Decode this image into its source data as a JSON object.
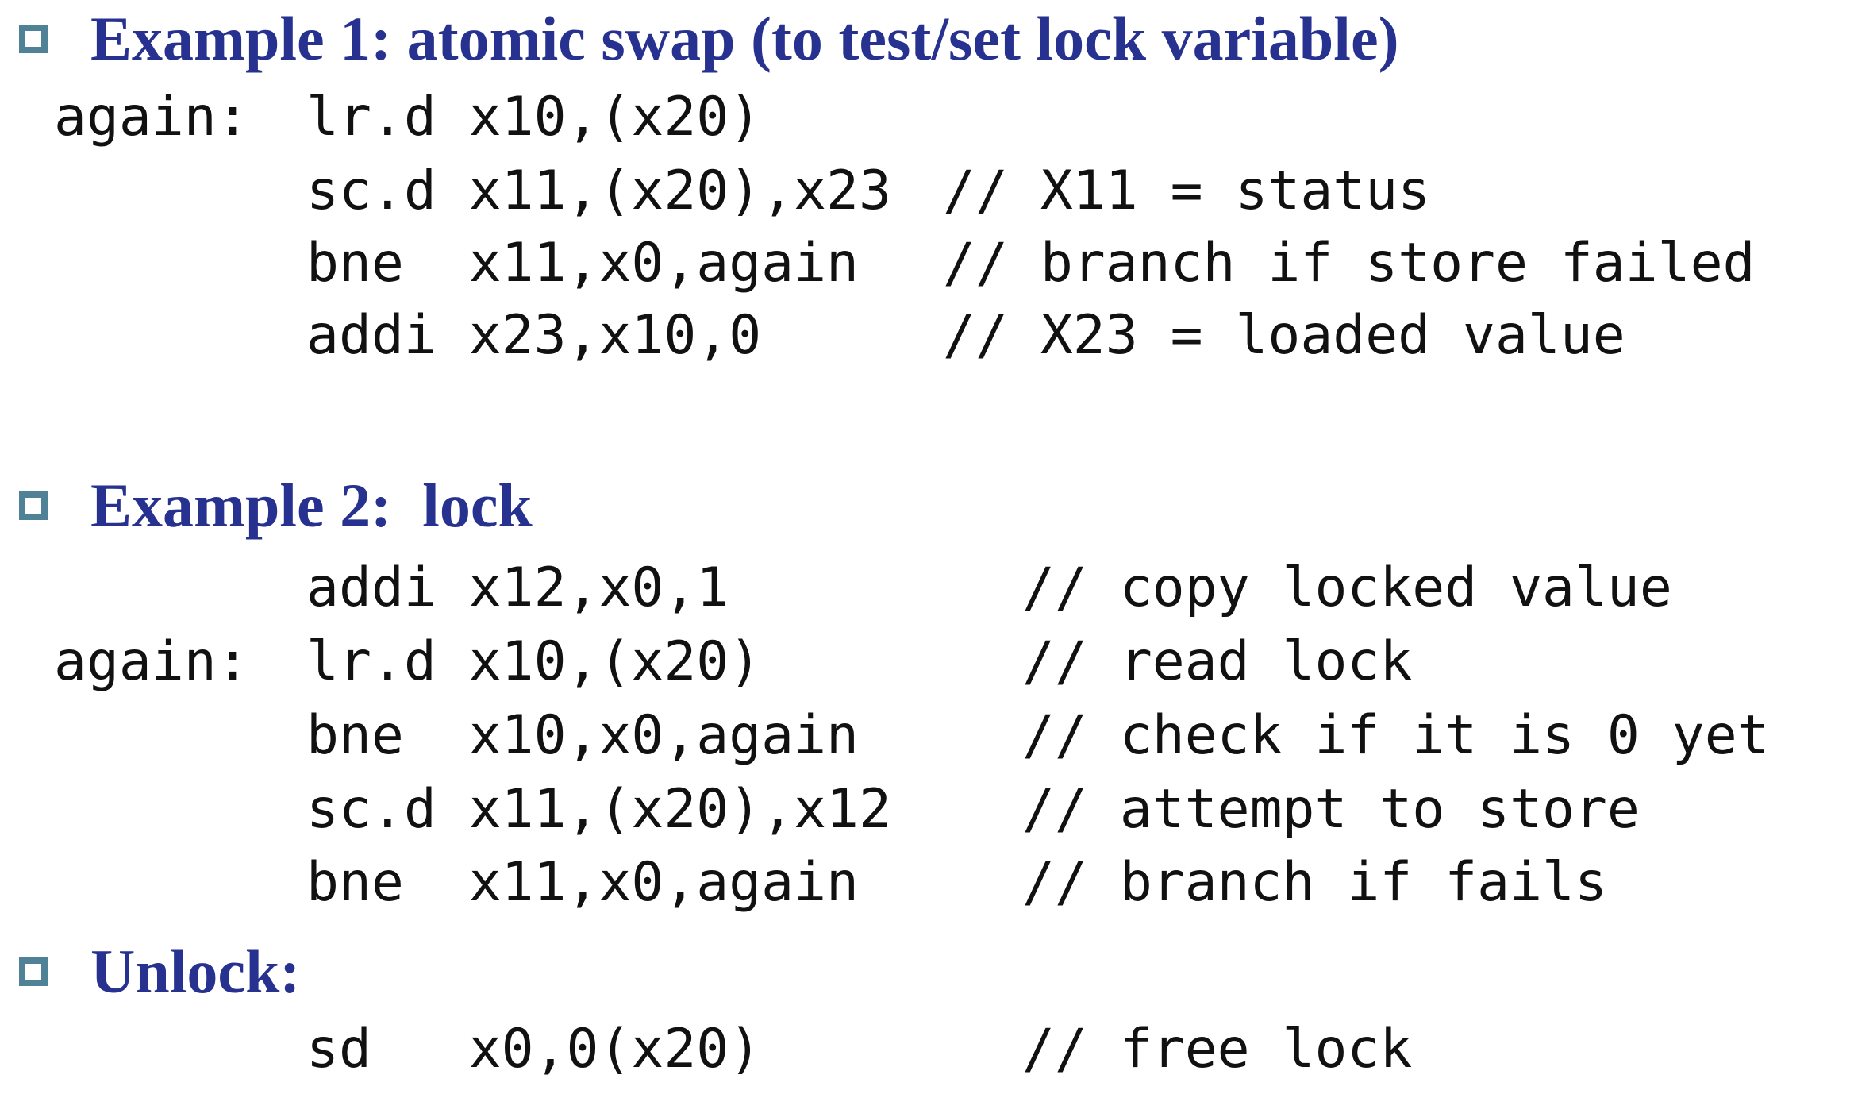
{
  "sections": [
    {
      "heading": "Example 1: atomic swap (to test/set lock variable)",
      "lines": [
        {
          "label": "again:",
          "instr": "lr.d x10,(x20)",
          "comment": ""
        },
        {
          "label": "",
          "instr": "sc.d x11,(x20),x23",
          "comment": "// X11 = status"
        },
        {
          "label": "",
          "instr": "bne  x11,x0,again",
          "comment": "// branch if store failed"
        },
        {
          "label": "",
          "instr": "addi x23,x10,0",
          "comment": "// X23 = loaded value"
        }
      ]
    },
    {
      "heading": "Example 2:  lock",
      "lines": [
        {
          "label": "",
          "instr": "addi x12,x0,1",
          "comment": "// copy locked value"
        },
        {
          "label": "again:",
          "instr": "lr.d x10,(x20)",
          "comment": "// read lock"
        },
        {
          "label": "",
          "instr": "bne  x10,x0,again",
          "comment": "// check if it is 0 yet"
        },
        {
          "label": "",
          "instr": "sc.d x11,(x20),x12",
          "comment": "// attempt to store"
        },
        {
          "label": "",
          "instr": "bne  x11,x0,again",
          "comment": "// branch if fails"
        }
      ]
    },
    {
      "heading": "Unlock:",
      "lines": [
        {
          "label": "",
          "instr": "sd   x0,0(x20)",
          "comment": "// free lock"
        }
      ]
    }
  ],
  "colors": {
    "heading": "#27318f",
    "bullet": "#4f8296",
    "code": "#111111"
  },
  "icons": {
    "bullet": "hollow-square-bullet-icon"
  }
}
